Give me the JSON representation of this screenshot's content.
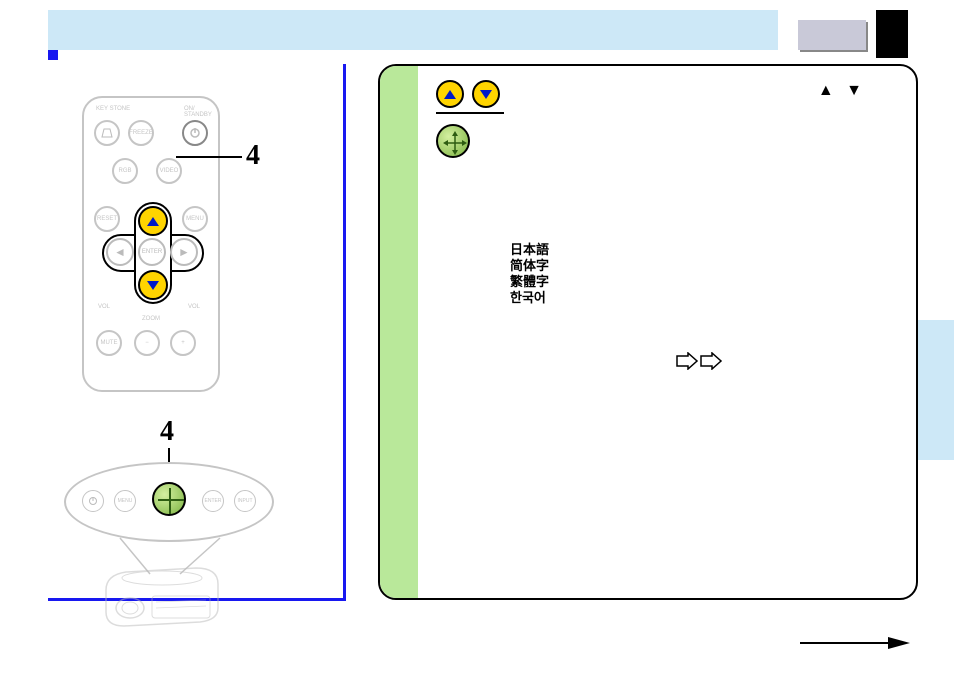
{
  "step_a": "4",
  "step_b": "4",
  "remote": {
    "keystone": "KEY\nSTONE",
    "onstandby": "ON/\nSTANDBY",
    "freeze": "FREEZE",
    "rgb": "RGB",
    "video": "VIDEO",
    "reset": "RESET",
    "menu": "MENU",
    "enter": "ENTER",
    "vol_minus": "VOL",
    "vol_plus": "VOL",
    "zoom": "ZOOM",
    "mute": "MUTE"
  },
  "panel": {
    "menu": "MENU",
    "enter": "ENTER",
    "input": "INPUT"
  },
  "menu": {
    "triangles": "▲  ▼",
    "languages": [
      "日本語",
      "简体字",
      "繁體字",
      "한국어"
    ]
  }
}
